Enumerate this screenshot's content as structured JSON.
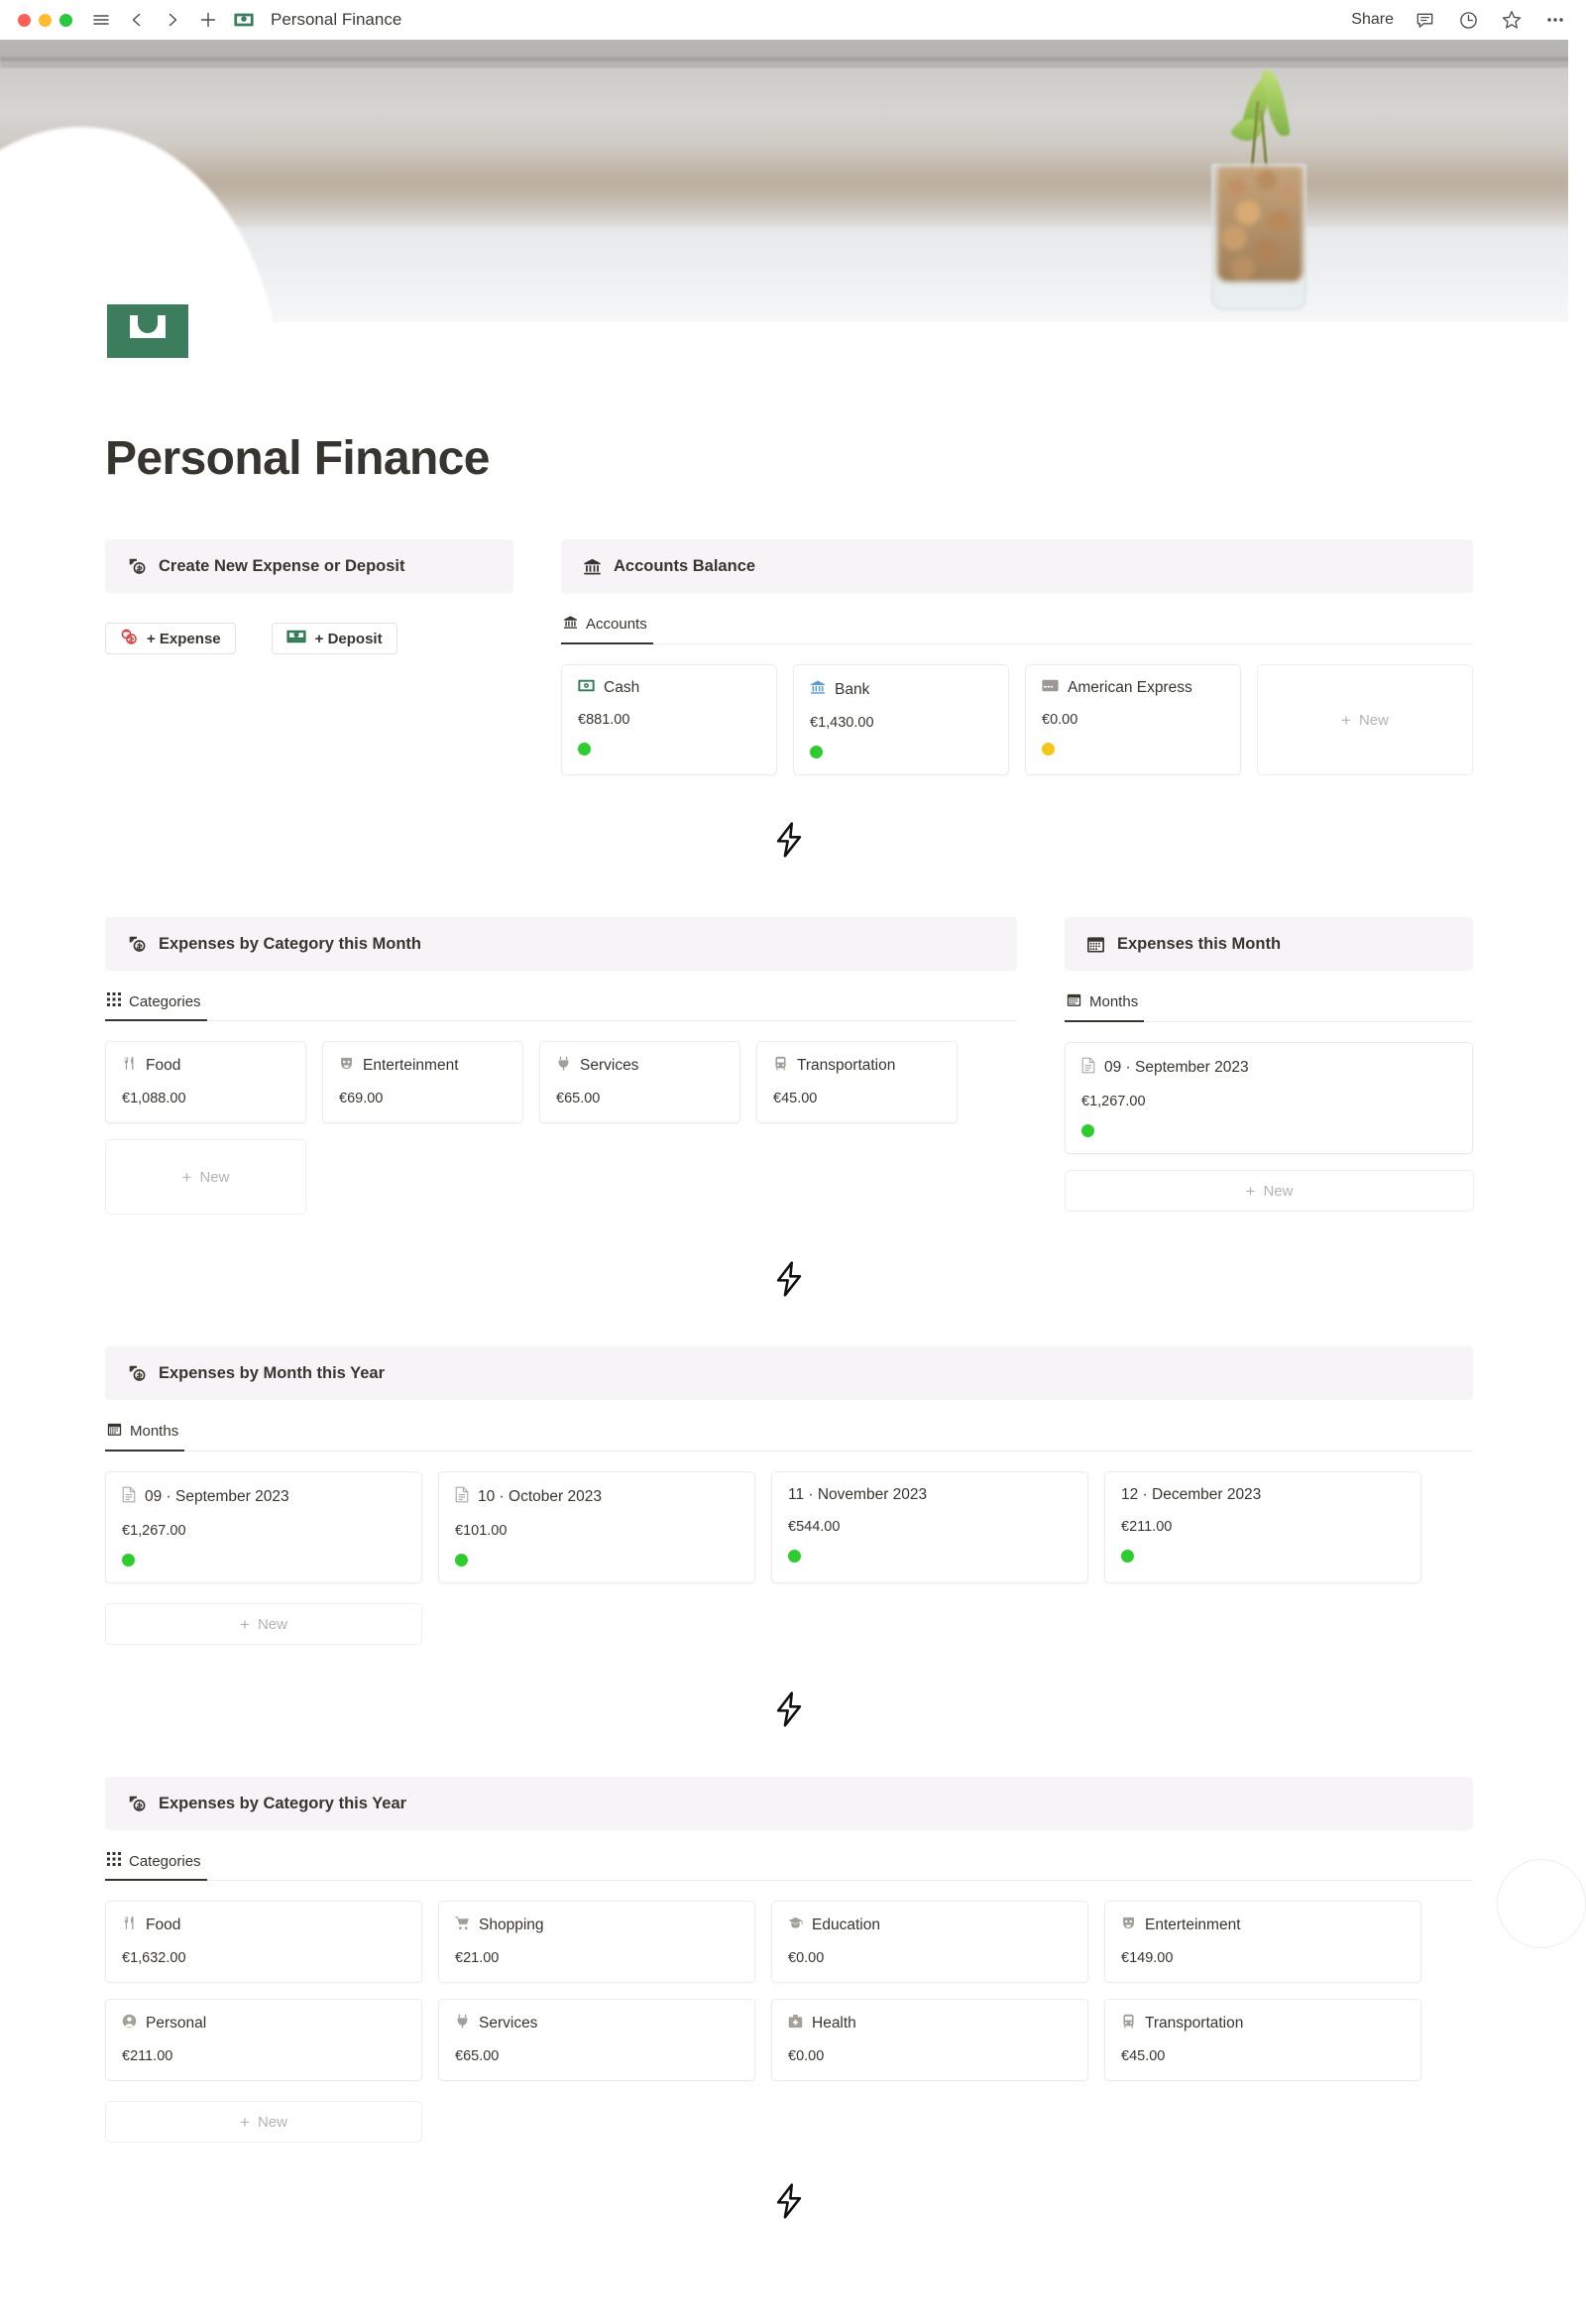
{
  "titlebar": {
    "menu_icon": "hamburger-icon",
    "back_icon": "chevron-left-icon",
    "forward_icon": "chevron-right-icon",
    "new_icon": "plus-icon",
    "page_emoji": "banknote-icon",
    "title": "Personal Finance",
    "share_label": "Share",
    "comment_icon": "comment-icon",
    "history_icon": "clock-icon",
    "favorite_icon": "star-icon",
    "more_icon": "ellipsis-icon"
  },
  "page": {
    "icon": "banknote-icon",
    "title": "Personal Finance"
  },
  "create_block": {
    "header": "Create New Expense or Deposit",
    "header_icon": "money-exchange-icon",
    "buttons": [
      {
        "label": "+ Expense",
        "icon": "coins-red-icon"
      },
      {
        "label": "+ Deposit",
        "icon": "banknote-green-icon"
      }
    ]
  },
  "accounts_block": {
    "header": "Accounts Balance",
    "header_icon": "bank-icon",
    "tab": {
      "label": "Accounts",
      "icon": "bank-icon"
    },
    "new_label": "New",
    "cards": [
      {
        "name": "Cash",
        "icon": "cash-icon",
        "value": "€881.00",
        "status_color": "#2fcc2f"
      },
      {
        "name": "Bank",
        "icon": "bank-blue-icon",
        "value": "€1,430.00",
        "status_color": "#2fcc2f"
      },
      {
        "name": "American Express",
        "icon": "credit-card-icon",
        "value": "€0.00",
        "status_color": "#f5c518"
      }
    ]
  },
  "category_month_block": {
    "header": "Expenses by Category this Month",
    "header_icon": "money-exchange-icon",
    "tab": {
      "label": "Categories",
      "icon": "grid-icon"
    },
    "new_label": "New",
    "cards": [
      {
        "name": "Food",
        "icon": "food-icon",
        "value": "€1,088.00"
      },
      {
        "name": "Enterteinment",
        "icon": "masks-icon",
        "value": "€69.00"
      },
      {
        "name": "Services",
        "icon": "plug-icon",
        "value": "€65.00"
      },
      {
        "name": "Transportation",
        "icon": "bus-icon",
        "value": "€45.00"
      }
    ]
  },
  "expenses_month_block": {
    "header": "Expenses this Month",
    "header_icon": "calendar-icon",
    "tab": {
      "label": "Months",
      "icon": "calendar-icon"
    },
    "new_label": "New",
    "cards": [
      {
        "name": "09 · September 2023",
        "icon": "document-icon",
        "value": "€1,267.00",
        "status_color": "#2fcc2f"
      }
    ]
  },
  "month_year_block": {
    "header": "Expenses by Month this Year",
    "header_icon": "money-exchange-icon",
    "tab": {
      "label": "Months",
      "icon": "calendar-icon"
    },
    "new_label": "New",
    "cards": [
      {
        "name": "09 · September 2023",
        "icon": "document-icon",
        "value": "€1,267.00",
        "status_color": "#2fcc2f"
      },
      {
        "name": "10 · October 2023",
        "icon": "document-icon",
        "value": "€101.00",
        "status_color": "#2fcc2f"
      },
      {
        "name": "11 · November 2023",
        "icon": "",
        "value": "€544.00",
        "status_color": "#2fcc2f"
      },
      {
        "name": "12 · December 2023",
        "icon": "",
        "value": "€211.00",
        "status_color": "#2fcc2f"
      }
    ]
  },
  "category_year_block": {
    "header": "Expenses by Category this Year",
    "header_icon": "money-exchange-icon",
    "tab": {
      "label": "Categories",
      "icon": "grid-icon"
    },
    "new_label": "New",
    "cards": [
      {
        "name": "Food",
        "icon": "food-icon",
        "value": "€1,632.00"
      },
      {
        "name": "Shopping",
        "icon": "cart-icon",
        "value": "€21.00"
      },
      {
        "name": "Education",
        "icon": "graduation-cap-icon",
        "value": "€0.00"
      },
      {
        "name": "Enterteinment",
        "icon": "masks-icon",
        "value": "€149.00"
      },
      {
        "name": "Personal",
        "icon": "person-icon",
        "value": "€211.00"
      },
      {
        "name": "Services",
        "icon": "plug-icon",
        "value": "€65.00"
      },
      {
        "name": "Health",
        "icon": "medical-bag-icon",
        "value": "€0.00"
      },
      {
        "name": "Transportation",
        "icon": "bus-icon",
        "value": "€45.00"
      }
    ]
  },
  "separator_icon": "lightning-bolt-icon",
  "colors": {
    "block_header_bg": "#f7f4f7",
    "accent_green": "#2fcc2f",
    "accent_yellow": "#f5c518",
    "expense_red": "#e03e3e",
    "deposit_green": "#2f7a52",
    "text": "#37352f",
    "muted": "#b4b3b0"
  }
}
